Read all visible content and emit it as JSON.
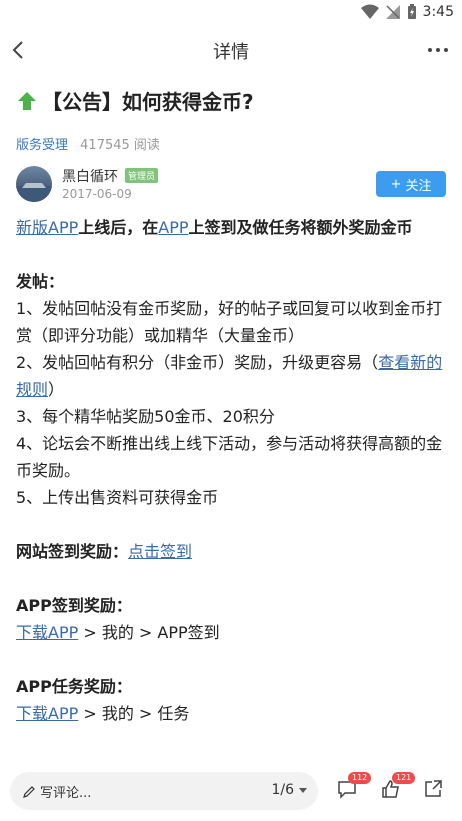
{
  "status_bar": {
    "time": "3:45"
  },
  "header": {
    "title": "详情"
  },
  "post": {
    "title": "【公告】如何获得金币?",
    "category": "版务受理",
    "views": "417545 阅读",
    "author": {
      "name": "黑白循环",
      "badge": "管理员",
      "date": "2017-06-09"
    },
    "follow_label": "关注"
  },
  "content": {
    "intro_link1": "新版APP",
    "intro_text1": "上线后，在",
    "intro_link2": "APP",
    "intro_text2": "上签到及做任务将额外奖励金币",
    "post_heading": "发帖：",
    "item1": "1、发帖回帖没有金币奖励，好的帖子或回复可以收到金币打赏（即评分功能）或加精华（大量金币）",
    "item2_text": "2、发帖回帖有积分（非金币）奖励，升级更容易（",
    "item2_link": "查看新的规则",
    "item2_end": "）",
    "item3": "3、每个精华帖奖励50金币、20积分",
    "item4": "4、论坛会不断推出线上线下活动，参与活动将获得高额的金币奖励。",
    "item5": "5、上传出售资料可获得金币",
    "site_checkin_label": "网站签到奖励：",
    "site_checkin_link": "点击签到",
    "app_checkin_label": "APP签到奖励：",
    "app_checkin_link": "下载APP",
    "app_checkin_path": " > 我的 > APP签到",
    "app_task_label": "APP任务奖励：",
    "app_task_link": "下载APP",
    "app_task_path": " > 我的 > 任务"
  },
  "bottom_bar": {
    "comment_placeholder": "写评论...",
    "page_indicator": "1/6",
    "comment_count": "112",
    "like_count": "121"
  },
  "colors": {
    "accent": "#3c9cf0",
    "link": "#3a69a8",
    "badge": "#7fc47a",
    "notice": "#f04b4b"
  }
}
